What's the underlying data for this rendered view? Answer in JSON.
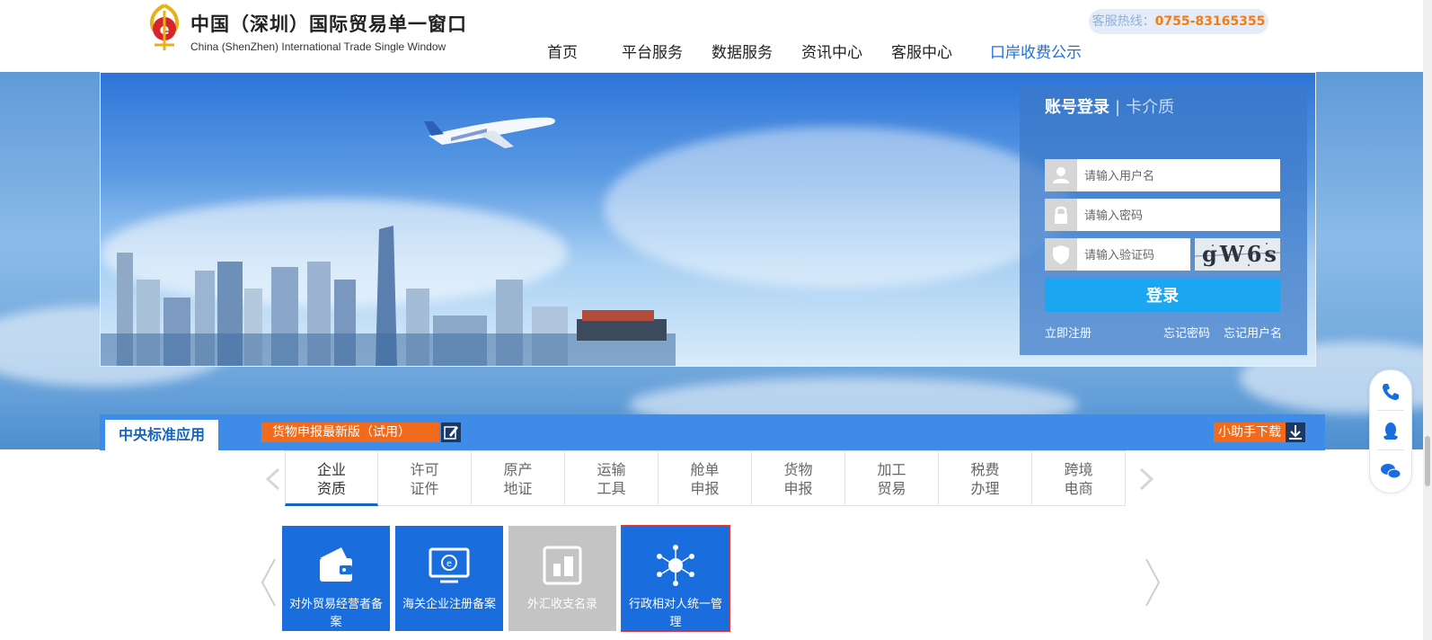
{
  "header": {
    "title_cn": "中国（深圳）国际贸易单一窗口",
    "title_en": "China (ShenZhen) International Trade Single Window",
    "hotline_label": "客服热线：",
    "hotline_number": "0755-83165355"
  },
  "nav": {
    "items": [
      "首页",
      "平台服务",
      "数据服务",
      "资讯中心",
      "客服中心",
      "口岸收费公示"
    ]
  },
  "login": {
    "tab_active": "账号登录",
    "tab_separator": "|",
    "tab_inactive": "卡介质",
    "username_placeholder": "请输入用户名",
    "password_placeholder": "请输入密码",
    "captcha_placeholder": "请输入验证码",
    "captcha_text": "gW6s",
    "submit_label": "登录",
    "register_link": "立即注册",
    "forgot_password_link": "忘记密码",
    "forgot_username_link": "忘记用户名"
  },
  "central": {
    "tab_label": "中央标准应用",
    "cargo_link": "货物申报最新版（试用）",
    "helper_download": "小助手下载"
  },
  "categories": [
    {
      "line1": "企业",
      "line2": "资质"
    },
    {
      "line1": "许可",
      "line2": "证件"
    },
    {
      "line1": "原产",
      "line2": "地证"
    },
    {
      "line1": "运输",
      "line2": "工具"
    },
    {
      "line1": "舱单",
      "line2": "申报"
    },
    {
      "line1": "货物",
      "line2": "申报"
    },
    {
      "line1": "加工",
      "line2": "贸易"
    },
    {
      "line1": "税费",
      "line2": "办理"
    },
    {
      "line1": "跨境",
      "line2": "电商"
    }
  ],
  "tiles": [
    {
      "label": "对外贸易经营者备案",
      "icon": "wallet-icon"
    },
    {
      "label": "海关企业注册备案",
      "icon": "monitor-icon"
    },
    {
      "label": "外汇收支名录",
      "icon": "document-icon"
    },
    {
      "label": "行政相对人统一管理",
      "icon": "network-icon"
    }
  ],
  "colors": {
    "brand_blue": "#1a6ddc",
    "accent_orange": "#f26a1b",
    "login_button": "#1aa6f0",
    "hotline_number": "#f57c13"
  },
  "side_icons": [
    "phone-icon",
    "qq-icon",
    "wechat-icon"
  ]
}
